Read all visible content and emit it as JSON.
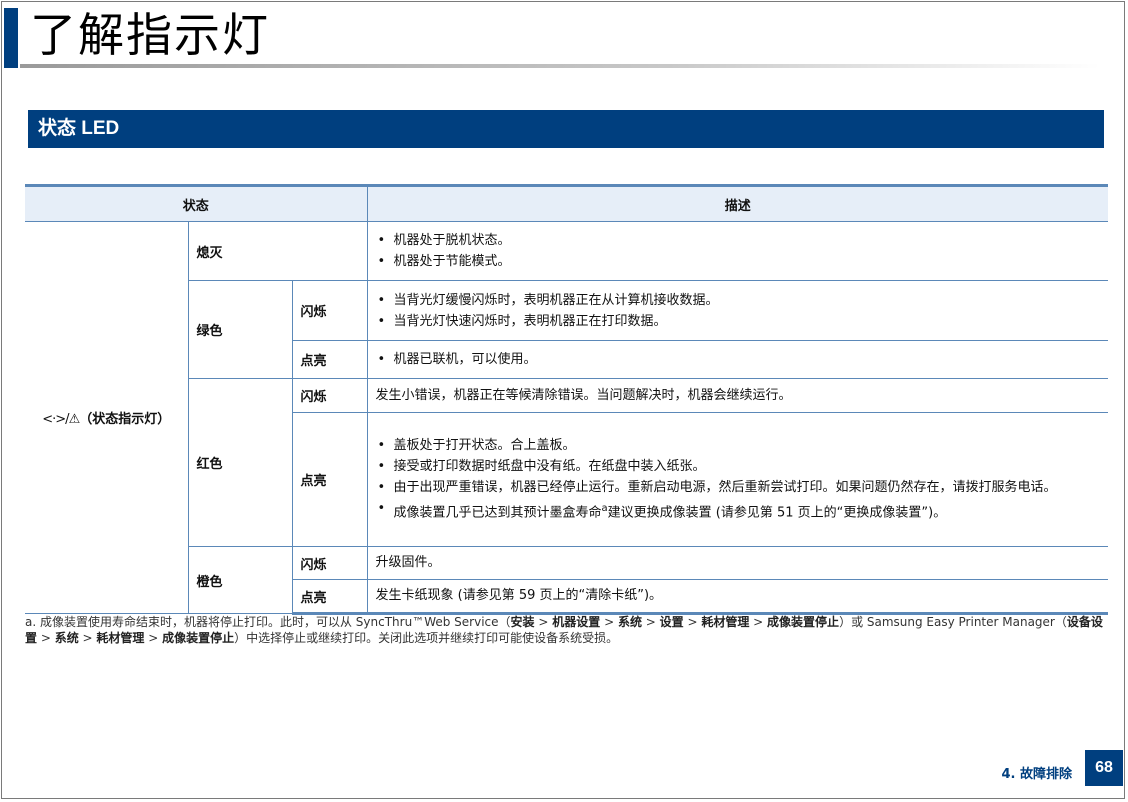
{
  "page": {
    "title": "了解指示灯",
    "section": "状态 LED",
    "footer_section": "4. 故障排除",
    "page_number": "68"
  },
  "table": {
    "headers": [
      "状态",
      "描述"
    ],
    "led_name": "（状态指示灯）",
    "led_icon": "network-warning-icon",
    "states": {
      "off": {
        "label": "熄灭",
        "desc": [
          "机器处于脱机状态。",
          "机器处于节能模式。"
        ]
      },
      "green": {
        "label": "绿色",
        "blinking": {
          "label": "闪烁",
          "desc": [
            "当背光灯缓慢闪烁时，表明机器正在从计算机接收数据。",
            "当背光灯快速闪烁时，表明机器正在打印数据。"
          ]
        },
        "on": {
          "label": "点亮",
          "desc": [
            "机器已联机，可以使用。"
          ]
        }
      },
      "red": {
        "label": "红色",
        "blinking": {
          "label": "闪烁",
          "desc": "发生小错误，机器正在等候清除错误。当问题解决时，机器会继续运行。"
        },
        "on": {
          "label": "点亮",
          "desc": [
            "盖板处于打开状态。合上盖板。",
            "接受或打印数据时纸盘中没有纸。在纸盘中装入纸张。",
            "由于出现严重错误，机器已经停止运行。重新启动电源，然后重新尝试打印。如果问题仍然存在，请拨打服务电话。"
          ],
          "desc_last_pre": "成像装置几乎已达到其预计墨盒寿命",
          "desc_last_sup": "a",
          "desc_last_post": "建议更换成像装置 (请参见第 51 页上的“更换成像装置”)。"
        }
      },
      "orange": {
        "label": "橙色",
        "blinking": {
          "label": "闪烁",
          "desc": "升级固件。"
        },
        "on": {
          "label": "点亮",
          "desc": "发生卡纸现象 (请参见第 59 页上的“清除卡纸”)。"
        }
      }
    }
  },
  "footnote": {
    "p1": "a. 成像装置使用寿命结束时，机器将停止打印。此时，可以从 SyncThru™Web Service（",
    "b1": "安装",
    "s1": " > ",
    "b2": "机器设置",
    "s2": " > ",
    "b3": "系统",
    "s3": " > ",
    "b4": "设置",
    "s4": " > ",
    "b5": "耗材管理",
    "s5": " > ",
    "b6": "成像装置停止",
    "p2": "）或 Samsung Easy Printer Manager（",
    "b7": "设备设置",
    "s6": " > ",
    "b8": "系统",
    "s7": " > ",
    "b9": "耗材管理",
    "s8": " > ",
    "b10": "成像装置停止",
    "p3": "）中选择停止或继续打印。关闭此选项并继续打印可能使设备系统受损。"
  }
}
